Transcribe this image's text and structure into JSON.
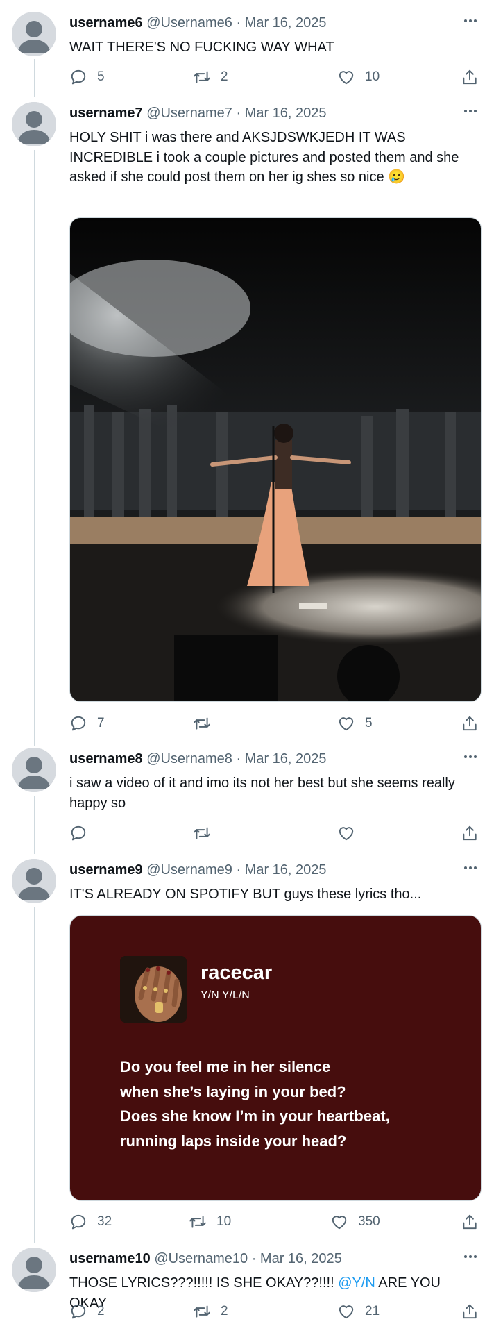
{
  "tweets": [
    {
      "username": "username6",
      "handle": "@Username6",
      "separator": "·",
      "date": "Mar 16, 2025",
      "text": "WAIT THERE'S NO FUCKING WAY WHAT",
      "replies": "5",
      "retweets": "2",
      "likes": "10"
    },
    {
      "username": "username7",
      "handle": "@Username7",
      "separator": "·",
      "date": "Mar 16, 2025",
      "text": "HOLY SHIT i was there and AKSJDSWKJEDH IT WAS INCREDIBLE i took a couple pictures and posted them and she asked if she could post them on her ig shes so nice 🥲",
      "replies": "7",
      "retweets": "",
      "likes": "5"
    },
    {
      "username": "username8",
      "handle": "@Username8",
      "separator": "·",
      "date": "Mar 16, 2025",
      "text": "i saw a video of it and imo its not her best but she seems really happy so",
      "replies": "",
      "retweets": "",
      "likes": ""
    },
    {
      "username": "username9",
      "handle": "@Username9",
      "separator": "·",
      "date": "Mar 16, 2025",
      "text": "IT'S ALREADY ON SPOTIFY BUT guys these lyrics tho...",
      "replies": "32",
      "retweets": "10",
      "likes": "350"
    },
    {
      "username": "username10",
      "handle": "@Username10",
      "separator": "·",
      "date": "Mar 16, 2025",
      "text_before": "THOSE LYRICS???!!!!! IS SHE OKAY??!!!! ",
      "mention": "@Y/N",
      "text_after": " ARE YOU OKAY",
      "replies": "2",
      "retweets": "2",
      "likes": "21"
    }
  ],
  "lyrics_card": {
    "song_title": "racecar",
    "artist": "Y/N Y/L/N",
    "lines": [
      "Do you feel me in her silence",
      "when she’s laying in your bed?",
      "Does she know I’m in your heartbeat,",
      "running laps inside your head?"
    ],
    "background": "#460d0d"
  },
  "colors": {
    "text": "#0f1419",
    "secondary": "#536471",
    "mention": "#1d9bf0",
    "thread_line": "#cfd9de"
  },
  "icons": [
    "avatar-placeholder",
    "more-icon",
    "reply-icon",
    "retweet-icon",
    "like-icon",
    "share-icon"
  ]
}
